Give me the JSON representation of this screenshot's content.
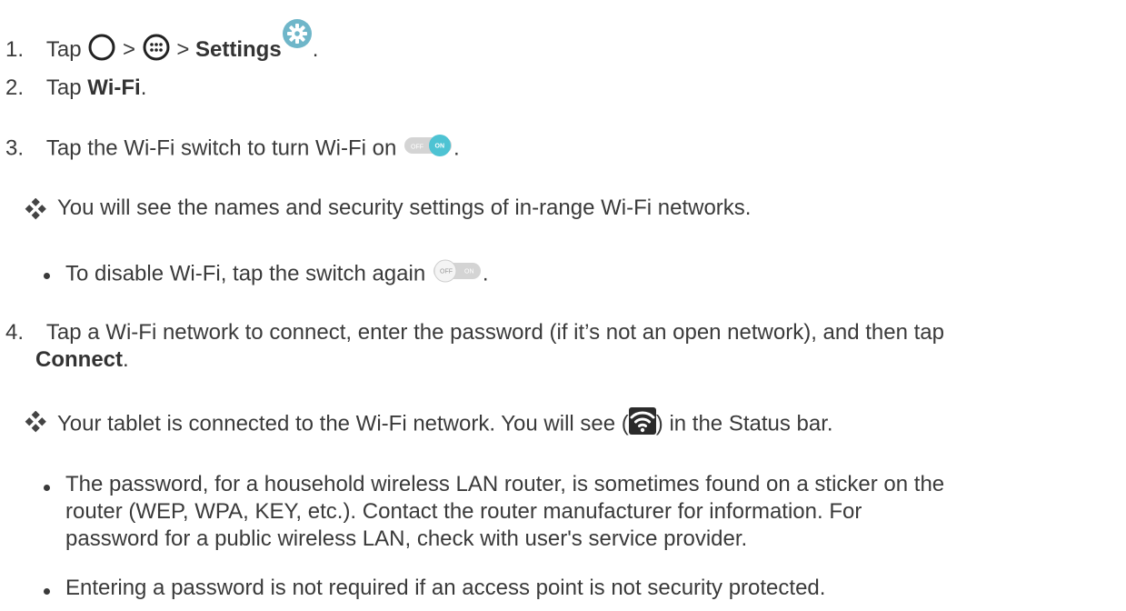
{
  "steps": {
    "s1": {
      "num": "1.",
      "t1": "Tap",
      "sep1": ">",
      "sep2": ">",
      "bold": "Settings",
      "end": "."
    },
    "s2": {
      "num": "2.",
      "t1": "Tap",
      "bold": "Wi-Fi",
      "end": "."
    },
    "s3": {
      "num": "3.",
      "t1": "Tap the Wi-Fi switch to turn Wi-Fi on",
      "end": "."
    },
    "s4": {
      "num": "4.",
      "line1": "Tap a Wi-Fi network to connect, enter the password (if it’s not an open network), and then tap",
      "bold": "Connect",
      "end": "."
    }
  },
  "results": {
    "r1": "You will see the names and security settings of in-range Wi-Fi networks.",
    "r2_a": "Your tablet is connected to the Wi-Fi network. You will see (",
    "r2_b": ") in the Status bar."
  },
  "bullets": {
    "b1": {
      "text": "To disable Wi-Fi, tap the switch again",
      "end": "."
    },
    "b2": [
      "The password, for a household wireless LAN router, is sometimes found on a sticker on the",
      "router (WEP, WPA, KEY, etc.). Contact the router manufacturer for information. For",
      "password for a public wireless LAN, check with user's service provider."
    ],
    "b3": "Entering a password is not required if an access point is not security protected."
  },
  "toggle_labels": {
    "off": "OFF",
    "on": "ON"
  },
  "toggles": {
    "first_state": "on",
    "second_state": "off"
  },
  "icons": {
    "home": "home-circle-icon",
    "apps": "apps-grid-icon",
    "settings": "gear-icon",
    "wifi": "wifi-status-icon",
    "result_marker": "diamond-cluster-icon"
  },
  "colors": {
    "toggle_on": "#4ec3d3",
    "settings_icon": "#6fb6c9",
    "text": "#3a3a3a"
  }
}
